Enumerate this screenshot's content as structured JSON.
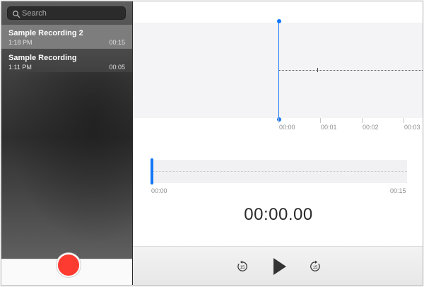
{
  "search": {
    "placeholder": "Search"
  },
  "recordings": [
    {
      "title": "Sample Recording 2",
      "time": "1:18 PM",
      "duration": "00:15",
      "selected": true
    },
    {
      "title": "Sample Recording",
      "time": "1:11 PM",
      "duration": "00:05",
      "selected": false
    }
  ],
  "timeline": {
    "ticks": [
      "00:00",
      "00:01",
      "00:02",
      "00:03"
    ]
  },
  "overview": {
    "start": "00:00",
    "end": "00:15"
  },
  "current_time": "00:00.00",
  "controls": {
    "skip_back": "15",
    "skip_forward": "15"
  },
  "colors": {
    "accent": "#1477f8",
    "record": "#fe3b30"
  },
  "icons": {
    "search": "search-icon",
    "skip_back": "skip-back-15-icon",
    "play": "play-icon",
    "skip_forward": "skip-forward-15-icon",
    "record": "record-icon"
  }
}
